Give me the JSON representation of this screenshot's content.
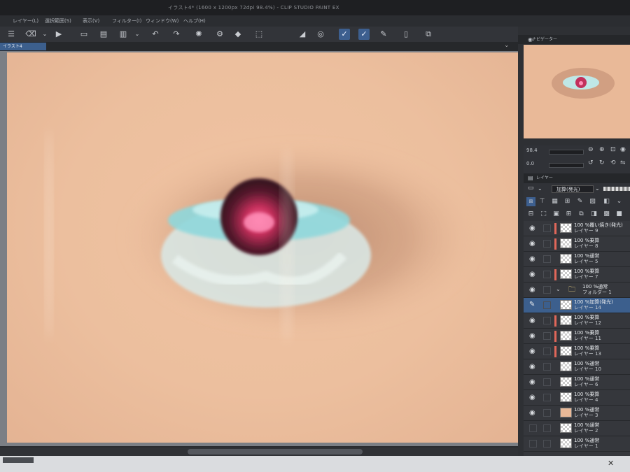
{
  "titlebar": {
    "text": "イラスト4* (1600 x 1200px 72dpi 98.4%) - CLIP STUDIO PAINT EX"
  },
  "menubar": {
    "items": [
      "レイヤー(L)",
      "選択範囲(S)",
      "表示(V)",
      "フィルター(I)",
      "ウィンドウ(W)",
      "ヘルプ(H)"
    ]
  },
  "toolbar": {
    "icons": [
      "menu-icon",
      "eraser-icon",
      "chevron-down-icon",
      "play-icon",
      "new-file-icon",
      "open-icon",
      "save-icon",
      "chevron-down-icon",
      "undo-icon",
      "redo-icon",
      "settings-icon",
      "gear-icon",
      "fill-icon",
      "transform-icon",
      "ruler-icon",
      "snap-icon",
      "pen-settings-icon",
      "pen-settings-icon",
      "edit-icon",
      "device-icon",
      "copy-icon"
    ]
  },
  "canvas_tab": {
    "label": "イラスト4"
  },
  "navigator": {
    "title": "ナビゲーター"
  },
  "nav_controls": {
    "zoom": "98.4",
    "rotate": "0.0"
  },
  "layer_panel": {
    "title": "レイヤー",
    "blend_mode": "加算(発光)"
  },
  "layers": [
    {
      "mode": "100 %覆い焼き(発光)",
      "name": "レイヤー 9",
      "clip": true,
      "visible": true,
      "thumb": "checker"
    },
    {
      "mode": "100 %乗算",
      "name": "レイヤー 8",
      "clip": true,
      "visible": true,
      "thumb": "checker"
    },
    {
      "mode": "100 %通常",
      "name": "レイヤー 5",
      "clip": false,
      "visible": true,
      "thumb": "checker"
    },
    {
      "mode": "100 %乗算",
      "name": "レイヤー 7",
      "clip": true,
      "visible": true,
      "thumb": "checker"
    },
    {
      "mode": "100 %通常",
      "name": "フォルダー 1",
      "clip": false,
      "visible": true,
      "thumb": "folder"
    },
    {
      "mode": "100 %加算(発光)",
      "name": "レイヤー 14",
      "clip": false,
      "visible": false,
      "thumb": "checker",
      "selected": true
    },
    {
      "mode": "100 %乗算",
      "name": "レイヤー 12",
      "clip": true,
      "visible": true,
      "thumb": "checker"
    },
    {
      "mode": "100 %乗算",
      "name": "レイヤー 11",
      "clip": true,
      "visible": true,
      "thumb": "checker"
    },
    {
      "mode": "100 %乗算",
      "name": "レイヤー 13",
      "clip": true,
      "visible": true,
      "thumb": "checker"
    },
    {
      "mode": "100 %通常",
      "name": "レイヤー 10",
      "clip": false,
      "visible": true,
      "thumb": "checker"
    },
    {
      "mode": "100 %通常",
      "name": "レイヤー 6",
      "clip": false,
      "visible": true,
      "thumb": "checker"
    },
    {
      "mode": "100 %乗算",
      "name": "レイヤー 4",
      "clip": false,
      "visible": true,
      "thumb": "checker"
    },
    {
      "mode": "100 %通常",
      "name": "レイヤー 3",
      "clip": false,
      "visible": true,
      "thumb": "solid"
    },
    {
      "mode": "100 %通常",
      "name": "レイヤー 2",
      "clip": false,
      "visible": false,
      "thumb": "checker"
    },
    {
      "mode": "100 %通常",
      "name": "レイヤー 1",
      "clip": false,
      "visible": false,
      "thumb": "checker"
    }
  ],
  "colors": {
    "accent": "#3c5f8d",
    "clip": "#e0675a",
    "skin": "#ecbf9e"
  }
}
